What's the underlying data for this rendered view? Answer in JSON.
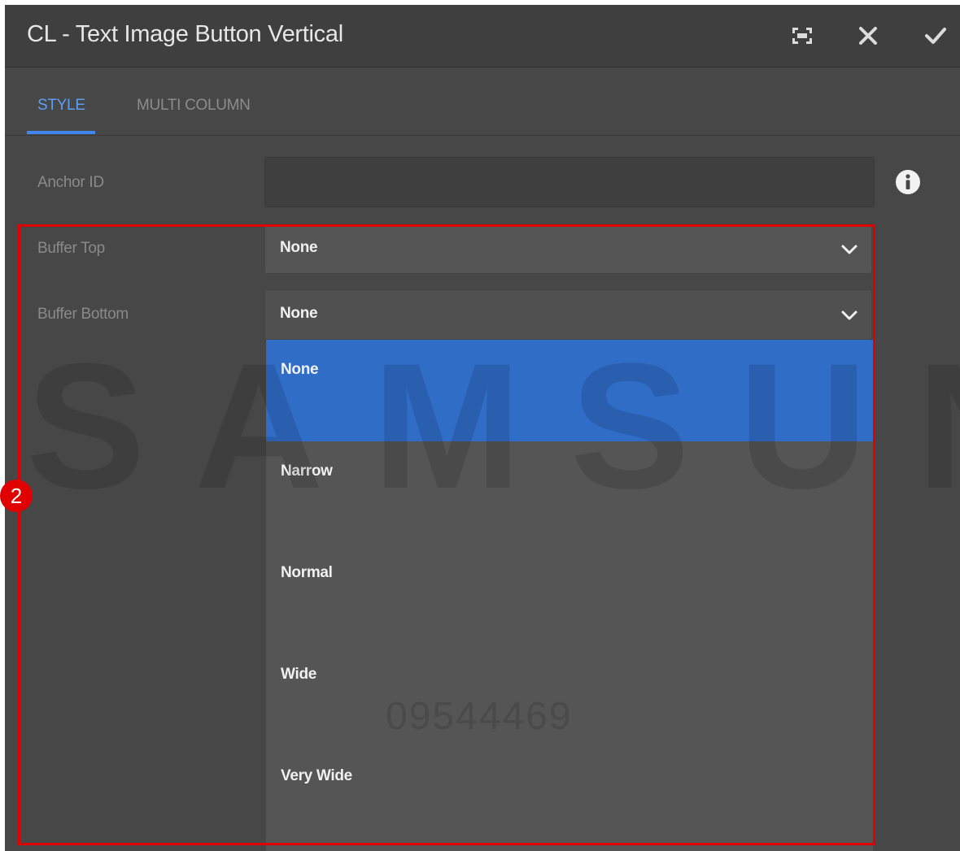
{
  "dialog": {
    "title": "CL - Text Image Button Vertical",
    "buttons": {
      "fullscreen_icon": "fullscreen-icon",
      "close_icon": "close-icon",
      "confirm_icon": "checkmark-icon"
    }
  },
  "tabs": [
    {
      "label": "STYLE",
      "active": true
    },
    {
      "label": "MULTI COLUMN",
      "active": false
    }
  ],
  "fields": {
    "anchor_id": {
      "label": "Anchor ID",
      "value": "",
      "info_icon": "info-icon"
    },
    "buffer_top": {
      "label": "Buffer Top",
      "value": "None"
    },
    "buffer_bottom": {
      "label": "Buffer Bottom",
      "value": "None",
      "open": true
    }
  },
  "dropdown_options": [
    {
      "label": "None",
      "selected": true
    },
    {
      "label": "Narrow",
      "selected": false
    },
    {
      "label": "Normal",
      "selected": false
    },
    {
      "label": "Wide",
      "selected": false
    },
    {
      "label": "Very Wide",
      "selected": false
    }
  ],
  "annotation": {
    "step_number": "2",
    "highlight_color": "#e00000"
  },
  "watermark": {
    "brand": "SAMSUNG",
    "code": "09544469"
  },
  "colors": {
    "accent": "#3f86ee",
    "selected_option": "#2f6dc7",
    "dialog_bg": "#474747"
  }
}
